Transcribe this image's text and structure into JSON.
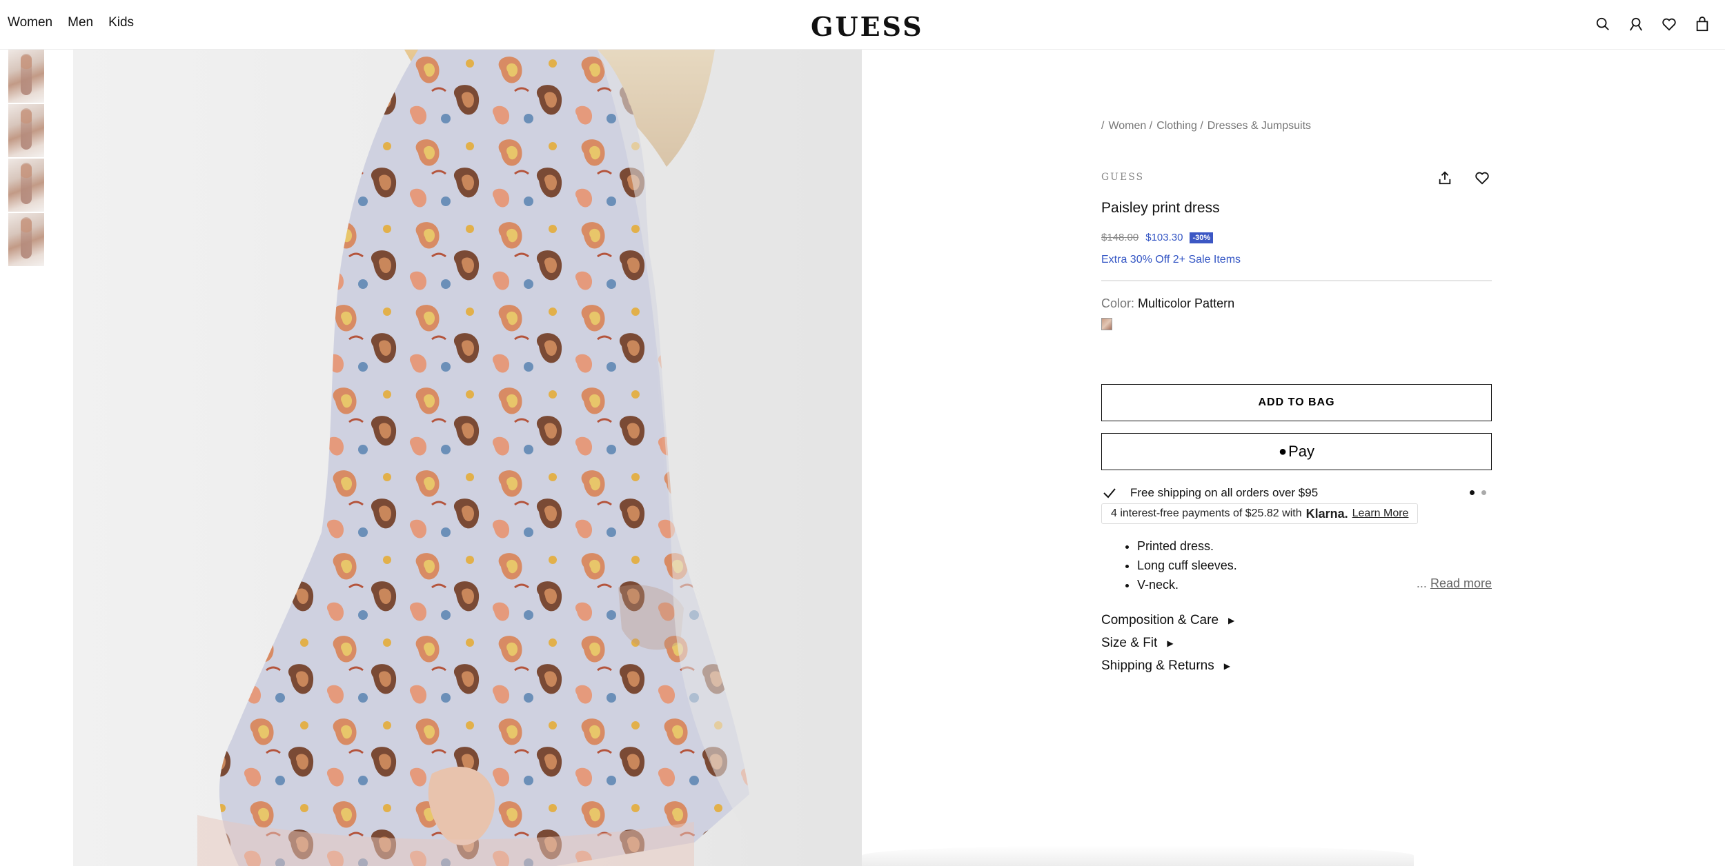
{
  "header": {
    "nav": [
      "Women",
      "Men",
      "Kids"
    ],
    "logo": "GUESS",
    "icons": [
      "search-icon",
      "account-icon",
      "wishlist-icon",
      "bag-icon"
    ]
  },
  "gallery": {
    "thumbnails": 4,
    "main_image": "paisley-dress-photo"
  },
  "product": {
    "breadcrumbs": [
      "/",
      "Women /",
      "Clothing /",
      "Dresses & Jumpsuits"
    ],
    "brand": "GUESS",
    "title": "Paisley print dress",
    "original_price": "$148.00",
    "sale_price": "$103.30",
    "discount": "-30%",
    "promo": "Extra 30% Off 2+ Sale Items",
    "color_label": "Color:",
    "color_value": "Multicolor Pattern",
    "add_to_bag": "ADD TO BAG",
    "apple_pay": "Pay",
    "shipping": "Free shipping on all orders over $95",
    "klarna": {
      "text": "4 interest-free payments of $25.82 with",
      "brand": "Klarna.",
      "link": "Learn More"
    },
    "bullets": [
      "Printed dress.",
      "Long cuff sleeves.",
      "V-neck."
    ],
    "read_more_prefix": "...",
    "read_more": "Read more",
    "accordions": [
      "Composition & Care",
      "Size & Fit",
      "Shipping & Returns"
    ]
  },
  "colors": {
    "accent_blue": "#3355c4",
    "badge_blue": "#3c57c4"
  }
}
